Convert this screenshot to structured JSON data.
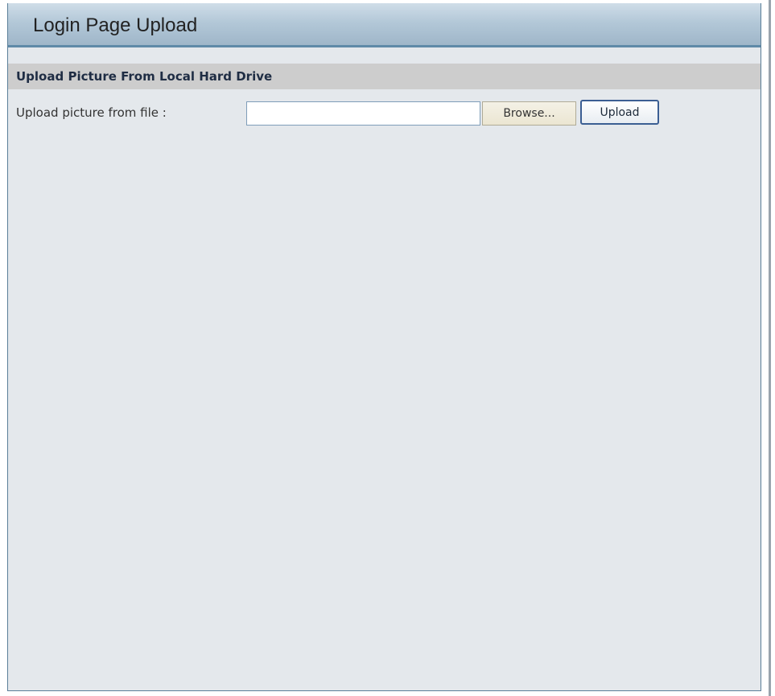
{
  "header": {
    "title": "Login Page Upload"
  },
  "upload_section": {
    "title": "Upload Picture From Local Hard Drive",
    "file_label": "Upload picture from file :",
    "file_value": "",
    "browse_label": "Browse...",
    "upload_label": "Upload"
  },
  "colors": {
    "title_bar": "#b3c8d8",
    "title_underline": "#5f8aa8",
    "content_background": "#e4e8ec",
    "section_header": "#cdcdcd",
    "upload_button_border": "#3b5e93"
  }
}
